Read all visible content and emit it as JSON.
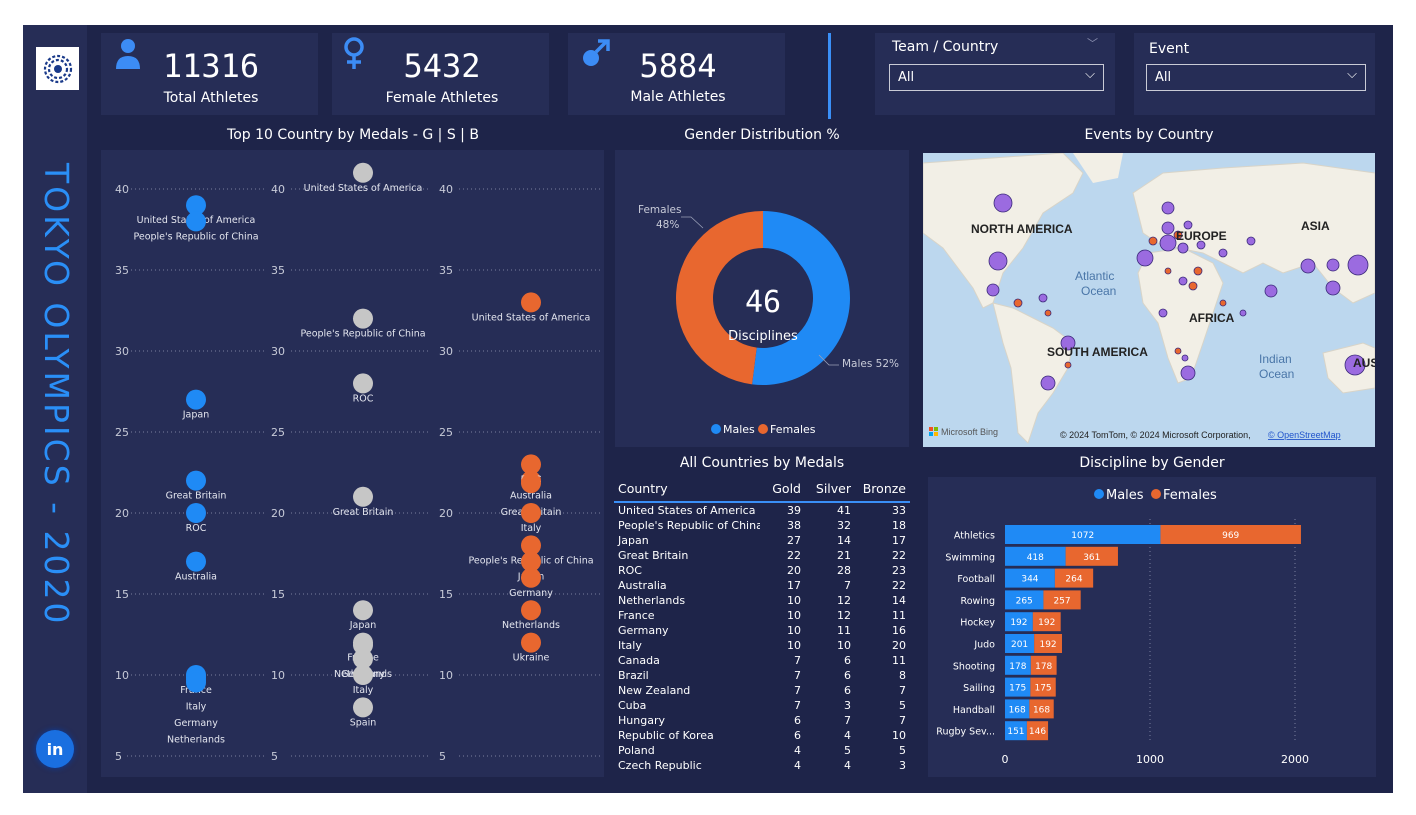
{
  "sidebar": {
    "title": "TOKYO OLYMPICS - 2020",
    "linkedin_label": "in"
  },
  "kpis": [
    {
      "value": "11316",
      "label": "Total Athletes",
      "icon": "person-icon"
    },
    {
      "value": "5432",
      "label": "Female Athletes",
      "icon": "female-icon"
    },
    {
      "value": "5884",
      "label": "Male Athletes",
      "icon": "male-icon"
    }
  ],
  "slicers": {
    "team": {
      "title": "Team / Country",
      "value": "All"
    },
    "event": {
      "title": "Event",
      "value": "All"
    }
  },
  "colors": {
    "gold": "#1f8af5",
    "silver": "#c6c6c6",
    "bronze": "#e8672f",
    "males": "#1f8af5",
    "females": "#e8672f",
    "accent": "#3a8ff7"
  },
  "medals_chart": {
    "title": "Top 10 Country by Medals - G | S | B",
    "yticks": [
      "40",
      "35",
      "30",
      "25",
      "20",
      "15",
      "10",
      "5"
    ],
    "gold": [
      {
        "country": "United States of America",
        "value": 39
      },
      {
        "country": "People's Republic of China",
        "value": 38
      },
      {
        "country": "Japan",
        "value": 27
      },
      {
        "country": "Great Britain",
        "value": 22
      },
      {
        "country": "ROC",
        "value": 20
      },
      {
        "country": "Australia",
        "value": 17
      },
      {
        "country": "France",
        "value": 10
      },
      {
        "country": "Italy",
        "value": 10
      },
      {
        "country": "Germany",
        "value": 10
      },
      {
        "country": "Netherlands",
        "value": 10
      }
    ],
    "silver": [
      {
        "country": "United States of America",
        "value": 41
      },
      {
        "country": "People's Republic of China",
        "value": 32
      },
      {
        "country": "ROC",
        "value": 28
      },
      {
        "country": "Great Britain",
        "value": 21
      },
      {
        "country": "Japan",
        "value": 14
      },
      {
        "country": "France",
        "value": 12
      },
      {
        "country": "Netherlands",
        "value": 12
      },
      {
        "country": "Germany",
        "value": 11
      },
      {
        "country": "Italy",
        "value": 10
      },
      {
        "country": "Spain",
        "value": 8
      }
    ],
    "bronze": [
      {
        "country": "United States of America",
        "value": 33
      },
      {
        "country": "Australia",
        "value": 22
      },
      {
        "country": "ROC",
        "value": 23
      },
      {
        "country": "Great Britain",
        "value": 22
      },
      {
        "country": "Italy",
        "value": 20
      },
      {
        "country": "People's Republic of China",
        "value": 18
      },
      {
        "country": "Japan",
        "value": 17
      },
      {
        "country": "Germany",
        "value": 16
      },
      {
        "country": "Netherlands",
        "value": 14
      },
      {
        "country": "Ukraine",
        "value": 12
      }
    ]
  },
  "gender_chart": {
    "title": "Gender Distribution %",
    "center_value": "46",
    "center_label": "Disciplines",
    "females_label": "Females",
    "females_pct": "48%",
    "males_label": "Males 52%",
    "males_value": 52,
    "females_value": 48,
    "legend": [
      "Males",
      "Females"
    ]
  },
  "map": {
    "title": "Events by Country",
    "labels": {
      "na": "NORTH AMERICA",
      "sa": "SOUTH AMERICA",
      "eu": "EUROPE",
      "as": "ASIA",
      "af": "AFRICA",
      "at": "Atlantic",
      "at2": "Ocean",
      "in": "Indian",
      "in2": "Ocean",
      "au": "AUST"
    },
    "bing": "Microsoft Bing",
    "copyright": "© 2024 TomTom, © 2024 Microsoft Corporation,",
    "osm": "© OpenStreetMap"
  },
  "table": {
    "title": "All Countries by Medals",
    "headers": [
      "Country",
      "Gold",
      "Silver",
      "Bronze"
    ],
    "rows": [
      [
        "United States of America",
        "39",
        "41",
        "33"
      ],
      [
        "People's Republic of China",
        "38",
        "32",
        "18"
      ],
      [
        "Japan",
        "27",
        "14",
        "17"
      ],
      [
        "Great Britain",
        "22",
        "21",
        "22"
      ],
      [
        "ROC",
        "20",
        "28",
        "23"
      ],
      [
        "Australia",
        "17",
        "7",
        "22"
      ],
      [
        "Netherlands",
        "10",
        "12",
        "14"
      ],
      [
        "France",
        "10",
        "12",
        "11"
      ],
      [
        "Germany",
        "10",
        "11",
        "16"
      ],
      [
        "Italy",
        "10",
        "10",
        "20"
      ],
      [
        "Canada",
        "7",
        "6",
        "11"
      ],
      [
        "Brazil",
        "7",
        "6",
        "8"
      ],
      [
        "New Zealand",
        "7",
        "6",
        "7"
      ],
      [
        "Cuba",
        "7",
        "3",
        "5"
      ],
      [
        "Hungary",
        "6",
        "7",
        "7"
      ],
      [
        "Republic of Korea",
        "6",
        "4",
        "10"
      ],
      [
        "Poland",
        "4",
        "5",
        "5"
      ],
      [
        "Czech Republic",
        "4",
        "4",
        "3"
      ]
    ]
  },
  "chart_data": {
    "type": "bar",
    "title": "Discipline by Gender",
    "categories": [
      "Athletics",
      "Swimming",
      "Football",
      "Rowing",
      "Hockey",
      "Judo",
      "Shooting",
      "Sailing",
      "Handball",
      "Rugby Sev..."
    ],
    "series": [
      {
        "name": "Males",
        "values": [
          1072,
          418,
          344,
          265,
          192,
          201,
          178,
          175,
          168,
          151
        ]
      },
      {
        "name": "Females",
        "values": [
          969,
          361,
          264,
          257,
          192,
          192,
          178,
          175,
          168,
          146
        ]
      }
    ],
    "stacked": true,
    "orientation": "horizontal",
    "xlim": [
      0,
      2100
    ],
    "xticks": [
      "0",
      "1000",
      "2000"
    ],
    "legend": [
      "Males",
      "Females"
    ],
    "legend_position": "top-center",
    "grid": true
  }
}
